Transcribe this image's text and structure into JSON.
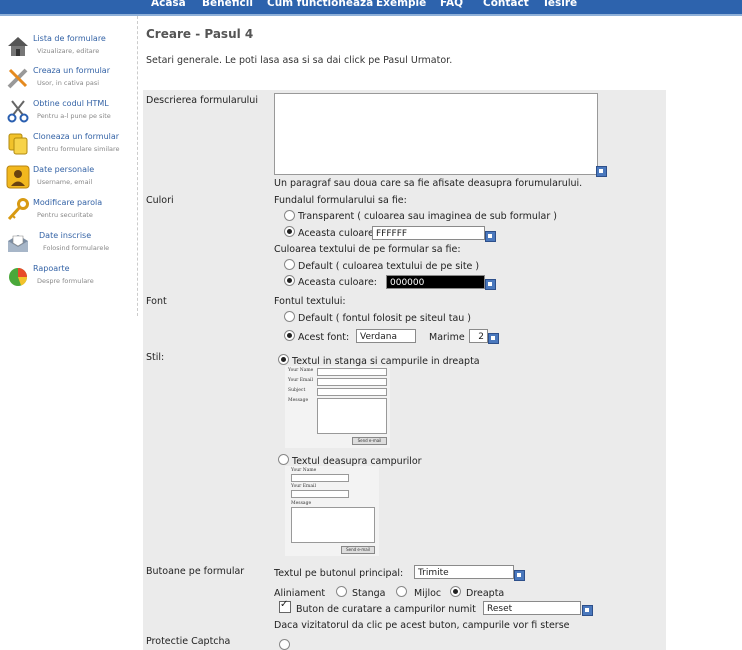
{
  "topnav": {
    "items": [
      "Acasa",
      "Beneficii",
      "Cum functioneaza",
      "Exemple",
      "FAQ",
      "Contact",
      "Iesire"
    ]
  },
  "sidebar": {
    "items": [
      {
        "label": "Lista de formulare",
        "sub": "Vizualizare, editare",
        "icon": "house-icon"
      },
      {
        "label": "Creaza un formular",
        "sub": "Usor, in cativa pasi",
        "icon": "tools-icon"
      },
      {
        "label": "Obtine codul HTML",
        "sub": "Pentru a-l pune pe site",
        "icon": "scissors-icon"
      },
      {
        "label": "Cloneaza un formular",
        "sub": "Pentru formulare similare",
        "icon": "copy-icon"
      },
      {
        "label": "Date personale",
        "sub": "Username, email",
        "icon": "user-icon"
      },
      {
        "label": "Modificare parola",
        "sub": "Pentru securitate",
        "icon": "key-icon"
      },
      {
        "label": "Date inscrise",
        "sub": "Folosind formularele",
        "icon": "mail-icon"
      },
      {
        "label": "Rapoarte",
        "sub": "Despre formulare",
        "icon": "pie-chart-icon"
      }
    ]
  },
  "main": {
    "title": "Creare - Pasul 4",
    "intro": "Setari generale. Le poti lasa asa si sa dai click pe Pasul Urmator."
  },
  "form": {
    "description": {
      "label": "Descrierea formularului",
      "help": "Un paragraf sau doua care sa fie afisate deasupra forumularului."
    },
    "colors": {
      "label": "Culori",
      "bg_heading": "Fundalul formularului sa fie:",
      "bg_transparent": "Transparent ( culoarea sau imaginea de sub formular )",
      "bg_custom": "Aceasta culoare:",
      "bg_value": "FFFFFF",
      "text_heading": "Culoarea textului de pe formular sa fie:",
      "text_default": "Default ( culoarea textului de pe site )",
      "text_custom": "Aceasta culoare:",
      "text_value": "000000"
    },
    "font": {
      "label": "Font",
      "heading": "Fontul textului:",
      "default": "Default ( fontul folosit pe siteul tau )",
      "custom": "Acest font:",
      "font_value": "Verdana",
      "size_label": "Marime",
      "size_value": "2"
    },
    "style": {
      "label": "Stil:",
      "option1": "Textul in stanga si campurile in dreapta",
      "option2": "Textul deasupra campurilor",
      "preview1": {
        "name": "Your Name",
        "email": "Your Email",
        "subject": "Subject",
        "message": "Message",
        "button": "Send e-mail"
      },
      "preview2": {
        "name": "Your Name",
        "email": "Your Email",
        "message": "Message",
        "button": "Send e-mail"
      }
    },
    "buttons": {
      "label": "Butoane pe formular",
      "main_label": "Textul pe butonul principal:",
      "main_value": "Trimite",
      "align_label": "Aliniament",
      "align_left": "Stanga",
      "align_center": "Mijloc",
      "align_right": "Dreapta",
      "reset_label": "Buton de curatare a campurilor numit",
      "reset_value": "Reset",
      "reset_help": "Daca vizitatorul da clic pe acest buton, campurile vor fi sterse"
    },
    "captcha": {
      "label": "Protectie Captcha"
    }
  },
  "colors": {
    "nav_bg": "#2d63ad",
    "link": "#3463a6",
    "panel_bg": "#ebebeb"
  }
}
